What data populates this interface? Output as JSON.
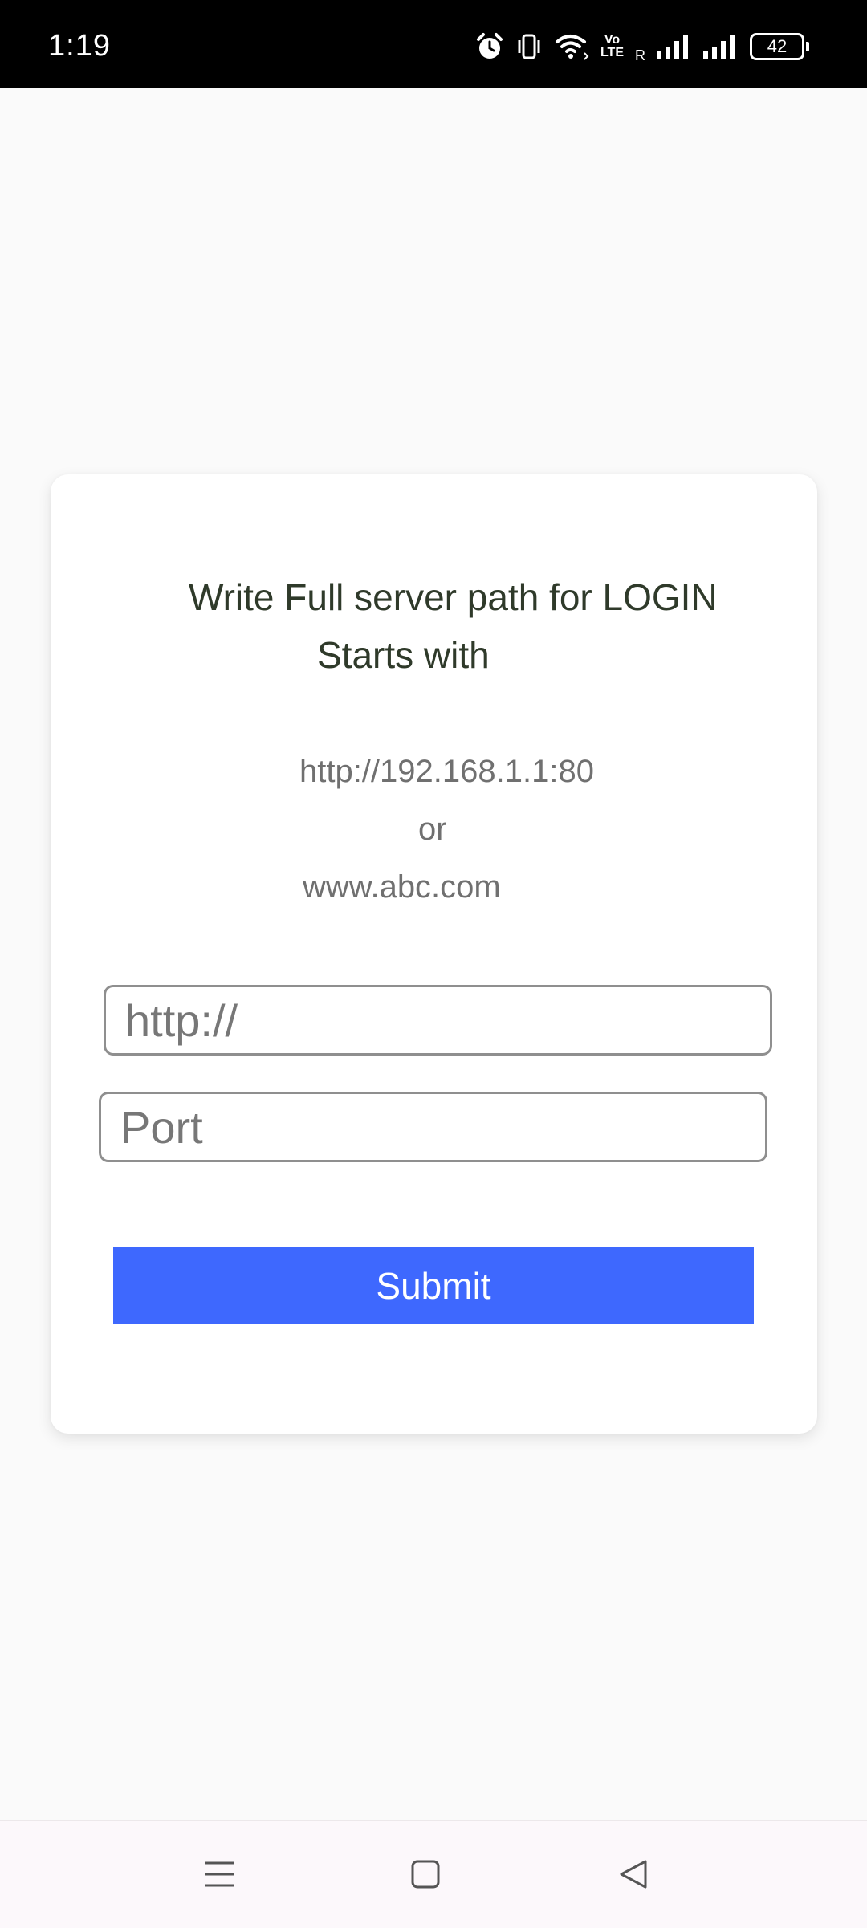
{
  "status_bar": {
    "time": "1:19",
    "battery": "42",
    "volte_top": "Vo",
    "volte_bottom": "LTE",
    "roaming": "R",
    "icons": [
      "alarm-icon",
      "vibrate-icon",
      "wifi-icon",
      "volte-icon",
      "signal-icon",
      "signal-icon",
      "battery-icon"
    ]
  },
  "card": {
    "title_line1": "Write Full server path for LOGIN",
    "title_line2": "Starts with",
    "example_ip": "http://192.168.1.1:80",
    "example_or": "or",
    "example_domain": "www.abc.com"
  },
  "form": {
    "url_placeholder": "http://",
    "url_value": "",
    "port_placeholder": "Port",
    "port_value": "",
    "submit_label": "Submit"
  },
  "nav": {
    "icons": [
      "menu-icon",
      "home-icon",
      "back-icon"
    ]
  },
  "colors": {
    "accent": "#3e68fe",
    "title_text": "#2f3a2a",
    "hint_text": "#707070",
    "status_bar_bg": "#000000"
  }
}
